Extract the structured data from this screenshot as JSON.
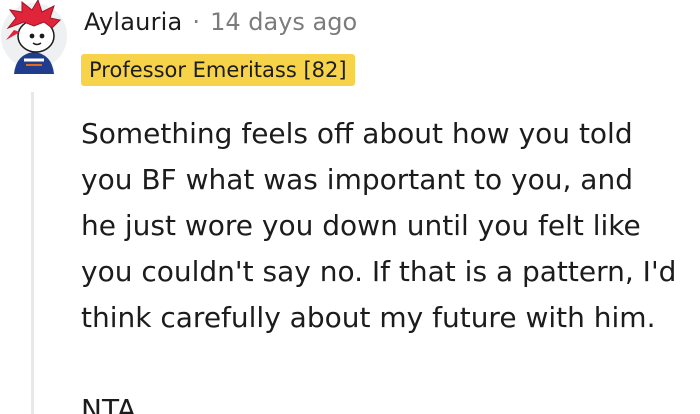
{
  "comment": {
    "username": "Aylauria",
    "separator": "·",
    "timestamp": "14 days ago",
    "flair": "Professor Emeritass [82]",
    "body": {
      "lines": [
        "Something feels off about how you told",
        "you BF what was important to you, and",
        "he just wore you down until you felt like",
        "you couldn't say no. If that is a pattern, I'd",
        "think carefully about my future with him."
      ],
      "verdict": "NTA"
    }
  },
  "avatar": {
    "hair_color": "#e0243a",
    "shirt_color": "#1f3d8c"
  },
  "colors": {
    "flair_bg": "#f7d34a",
    "thread_line": "#e6e8ea",
    "meta_text": "#7c7c7c"
  }
}
